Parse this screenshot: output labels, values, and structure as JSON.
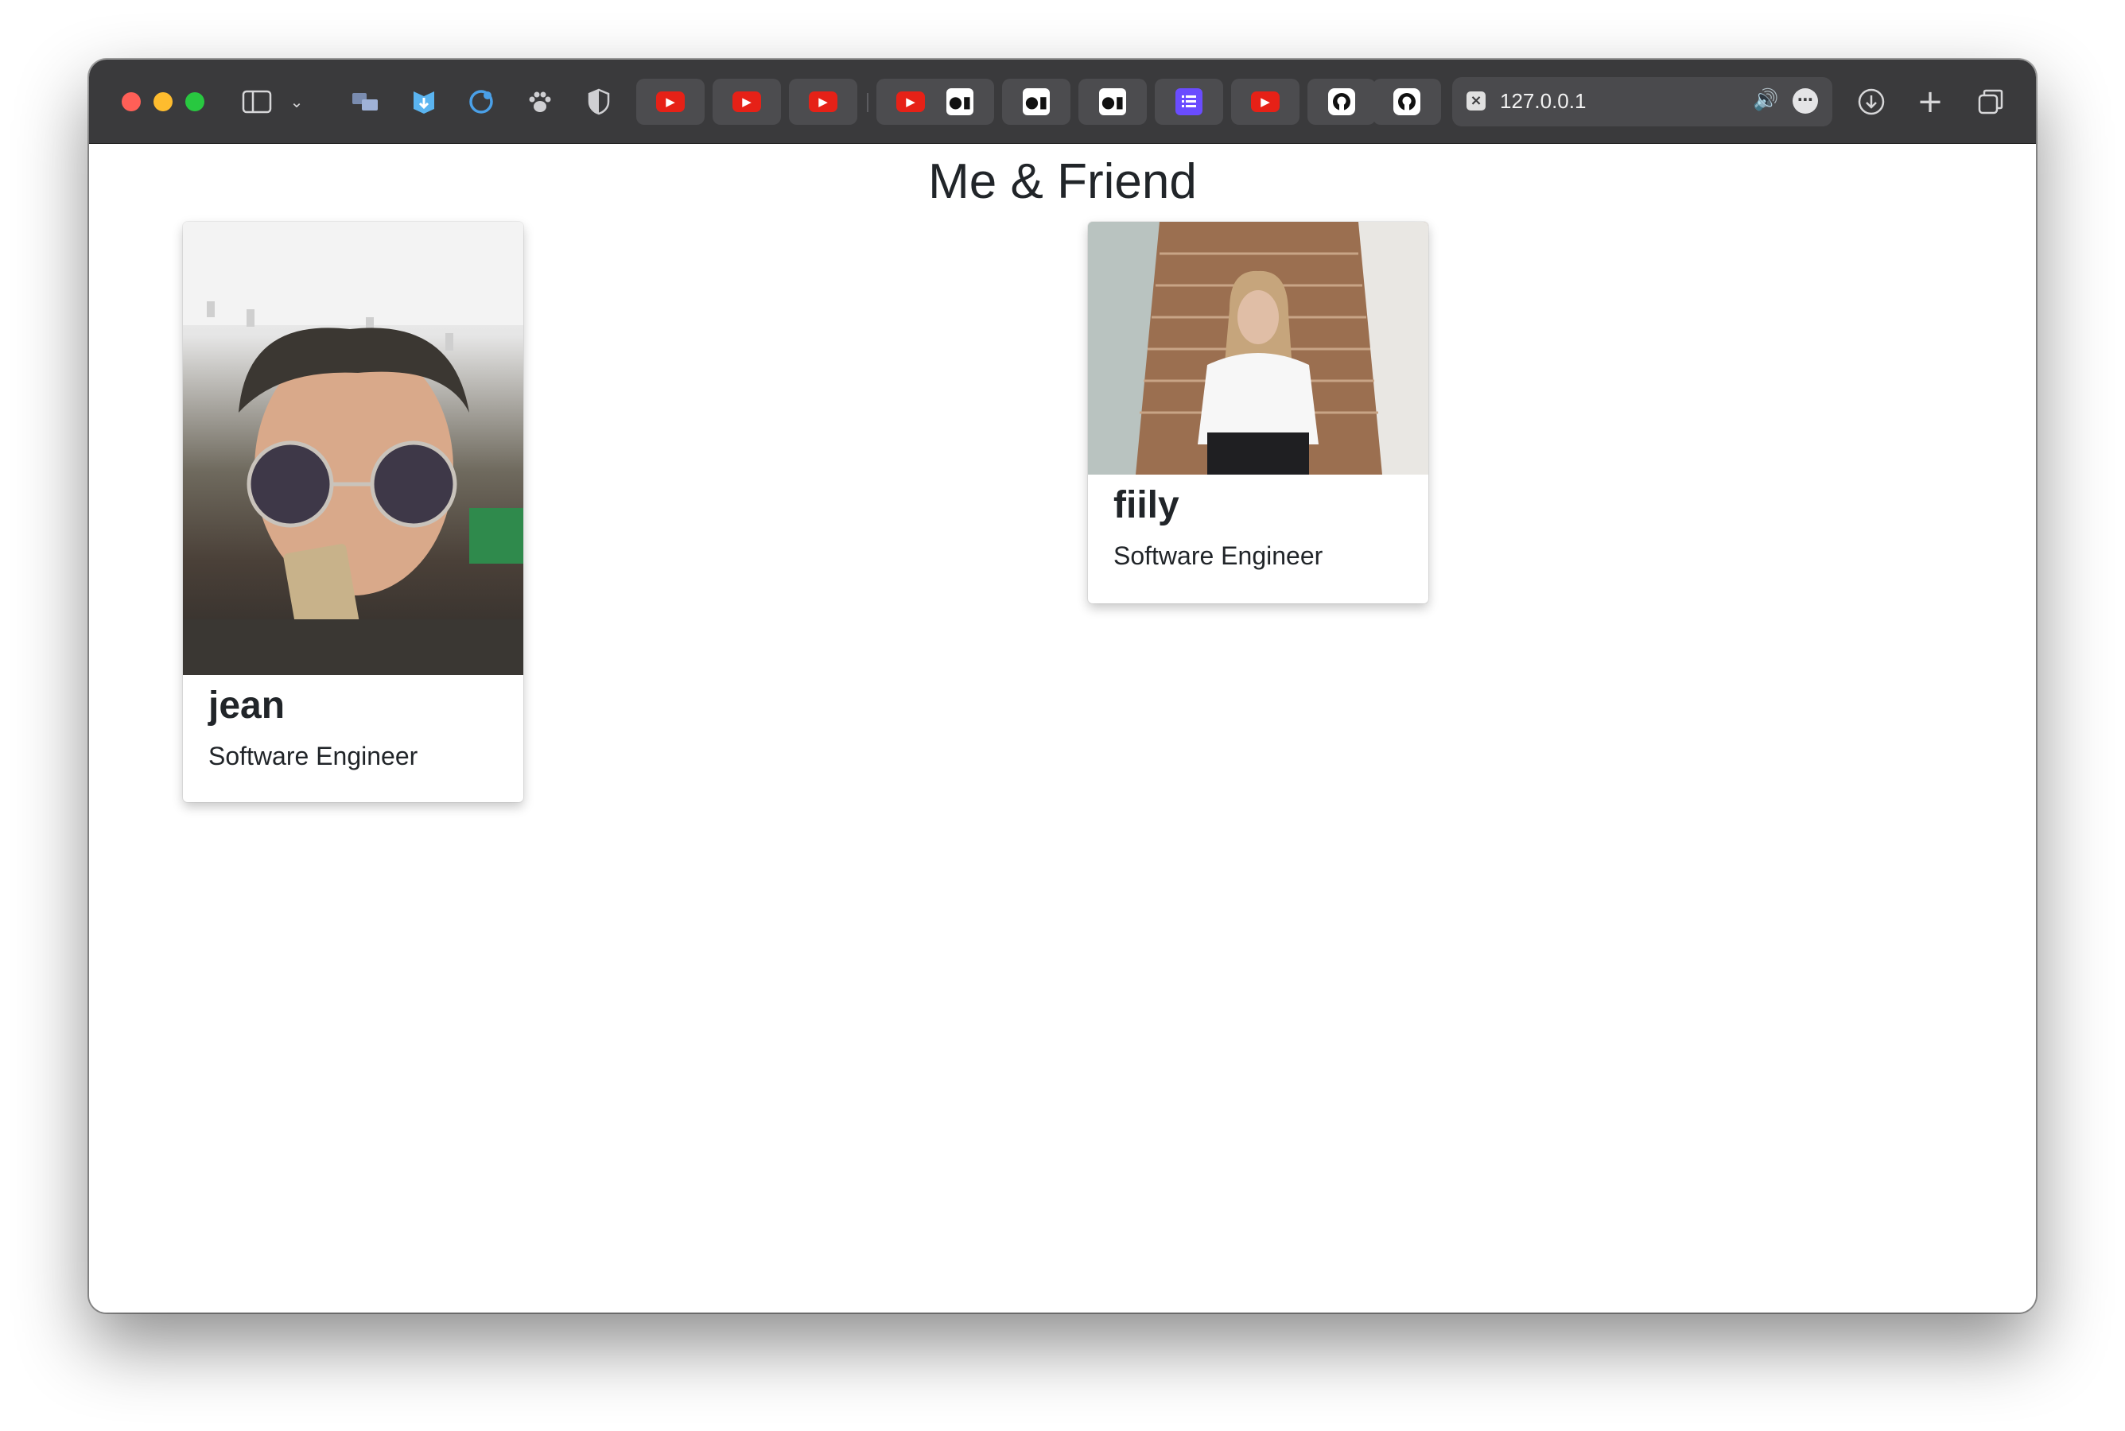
{
  "browser": {
    "url": "127.0.0.1",
    "pinned_tabs": [
      "youtube",
      "youtube",
      "youtube",
      "youtube",
      "medium",
      "medium",
      "medium",
      "list",
      "youtube",
      "github",
      "github"
    ]
  },
  "page": {
    "title": "Me & Friend",
    "cards": [
      {
        "name": "jean",
        "role": "Software Engineer"
      },
      {
        "name": "fiily",
        "role": "Software Engineer"
      }
    ]
  },
  "colors": {
    "toolbar": "#3a3a3c",
    "youtube": "#e62117",
    "text": "#212529"
  }
}
